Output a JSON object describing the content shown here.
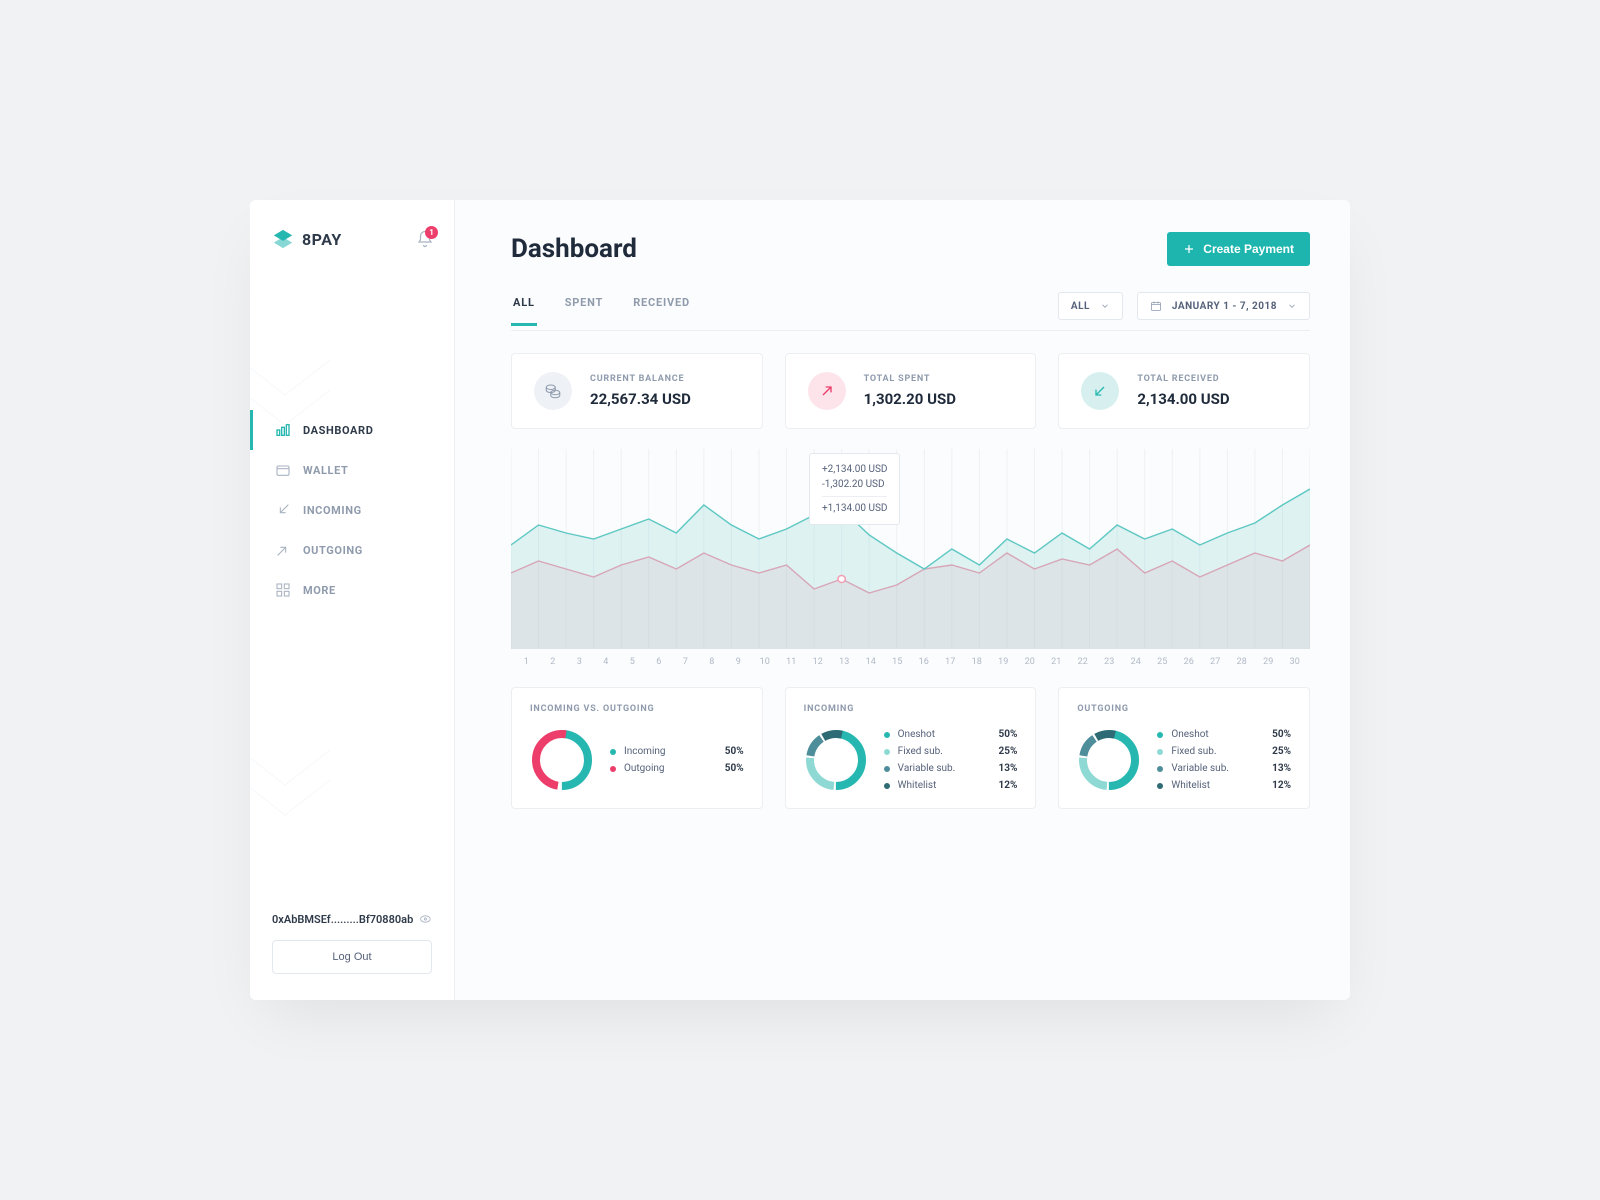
{
  "brand": "8PAY",
  "notifications": {
    "count": "1"
  },
  "sidebar": {
    "items": [
      {
        "label": "DASHBOARD",
        "icon": "chart-bar-icon"
      },
      {
        "label": "WALLET",
        "icon": "wallet-icon"
      },
      {
        "label": "INCOMING",
        "icon": "arrow-in-icon"
      },
      {
        "label": "OUTGOING",
        "icon": "arrow-out-icon"
      },
      {
        "label": "MORE",
        "icon": "grid-icon"
      }
    ],
    "address": "0xAbBMSEf.........Bf70880ab",
    "logout": "Log Out"
  },
  "header": {
    "title": "Dashboard",
    "create_label": "Create Payment"
  },
  "tabs": [
    "ALL",
    "SPENT",
    "RECEIVED"
  ],
  "filters": {
    "scope": "ALL",
    "date": "JANUARY 1 - 7, 2018"
  },
  "stats": {
    "balance": {
      "label": "CURRENT BALANCE",
      "value": "22,567.34 USD"
    },
    "spent": {
      "label": "TOTAL SPENT",
      "value": "1,302.20 USD"
    },
    "received": {
      "label": "TOTAL RECEIVED",
      "value": "2,134.00 USD"
    }
  },
  "chart_tooltip": {
    "in": "+2,134.00 USD",
    "out": "-1,302.20 USD",
    "net": "+1,134.00 USD"
  },
  "chart_data": {
    "type": "area",
    "x": [
      1,
      2,
      3,
      4,
      5,
      6,
      7,
      8,
      9,
      10,
      11,
      12,
      13,
      14,
      15,
      16,
      17,
      18,
      19,
      20,
      21,
      22,
      23,
      24,
      25,
      26,
      27,
      28,
      29,
      30
    ],
    "ylim": [
      0,
      100
    ],
    "series": [
      {
        "name": "Incoming",
        "color": "#5ec8c3",
        "values": [
          52,
          62,
          58,
          55,
          60,
          65,
          58,
          72,
          62,
          55,
          60,
          67,
          70,
          57,
          48,
          40,
          50,
          42,
          55,
          48,
          58,
          50,
          62,
          55,
          60,
          52,
          58,
          63,
          72,
          80
        ]
      },
      {
        "name": "Outgoing",
        "color": "#f29fb4",
        "values": [
          38,
          44,
          40,
          36,
          42,
          46,
          40,
          48,
          42,
          38,
          42,
          30,
          35,
          28,
          32,
          40,
          42,
          38,
          48,
          40,
          45,
          42,
          50,
          38,
          44,
          36,
          42,
          48,
          44,
          52
        ]
      }
    ],
    "tooltip_at_x": 13
  },
  "donuts": [
    {
      "title": "INCOMING VS. OUTGOING",
      "items": [
        {
          "label": "Incoming",
          "value": "50%",
          "color": "#25b7b0"
        },
        {
          "label": "Outgoing",
          "value": "50%",
          "color": "#ed3d6b"
        }
      ]
    },
    {
      "title": "INCOMING",
      "items": [
        {
          "label": "Oneshot",
          "value": "50%",
          "color": "#25b7b0"
        },
        {
          "label": "Fixed sub.",
          "value": "25%",
          "color": "#8fd9d5"
        },
        {
          "label": "Variable sub.",
          "value": "13%",
          "color": "#4e8d9a"
        },
        {
          "label": "Whitelist",
          "value": "12%",
          "color": "#2e6b74"
        }
      ]
    },
    {
      "title": "OUTGOING",
      "items": [
        {
          "label": "Oneshot",
          "value": "50%",
          "color": "#25b7b0"
        },
        {
          "label": "Fixed sub.",
          "value": "25%",
          "color": "#8fd9d5"
        },
        {
          "label": "Variable sub.",
          "value": "13%",
          "color": "#4e8d9a"
        },
        {
          "label": "Whitelist",
          "value": "12%",
          "color": "#2e6b74"
        }
      ]
    }
  ]
}
